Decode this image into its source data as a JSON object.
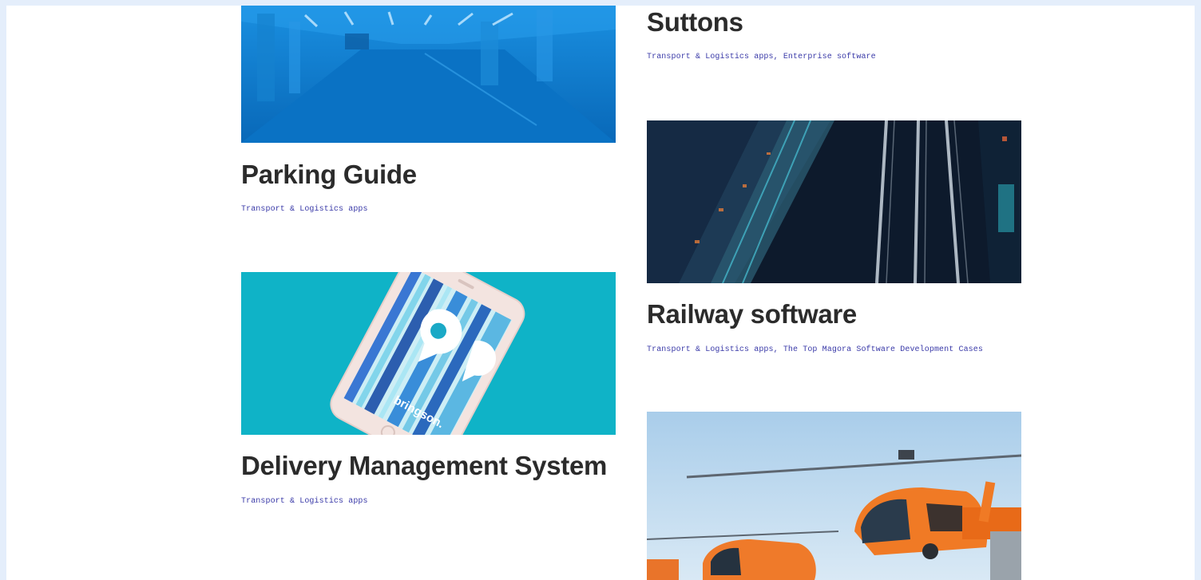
{
  "projects": [
    {
      "title": "Parking Guide",
      "tags": "Transport & Logistics apps",
      "image": "parking-garage-photo"
    },
    {
      "title": "Delivery Management System",
      "tags": "Transport & Logistics apps",
      "image": "bringson-phone-photo",
      "phone_brand": "bringson."
    },
    {
      "title": "Suttons",
      "tags": "Transport & Logistics apps, Enterprise software",
      "image": null
    },
    {
      "title": "Railway software",
      "tags": "Transport & Logistics apps, The Top Magora Software Development Cases",
      "image": "railway-night-aerial-photo"
    },
    {
      "title": "",
      "tags": "",
      "image": "helicopters-photo"
    }
  ],
  "colors": {
    "page_bg": "#e4eefb",
    "title": "#2b2b2b",
    "tag_link": "#3a3aa8",
    "parking_blue": "#0b7fd0",
    "teal": "#0fb3c7"
  }
}
